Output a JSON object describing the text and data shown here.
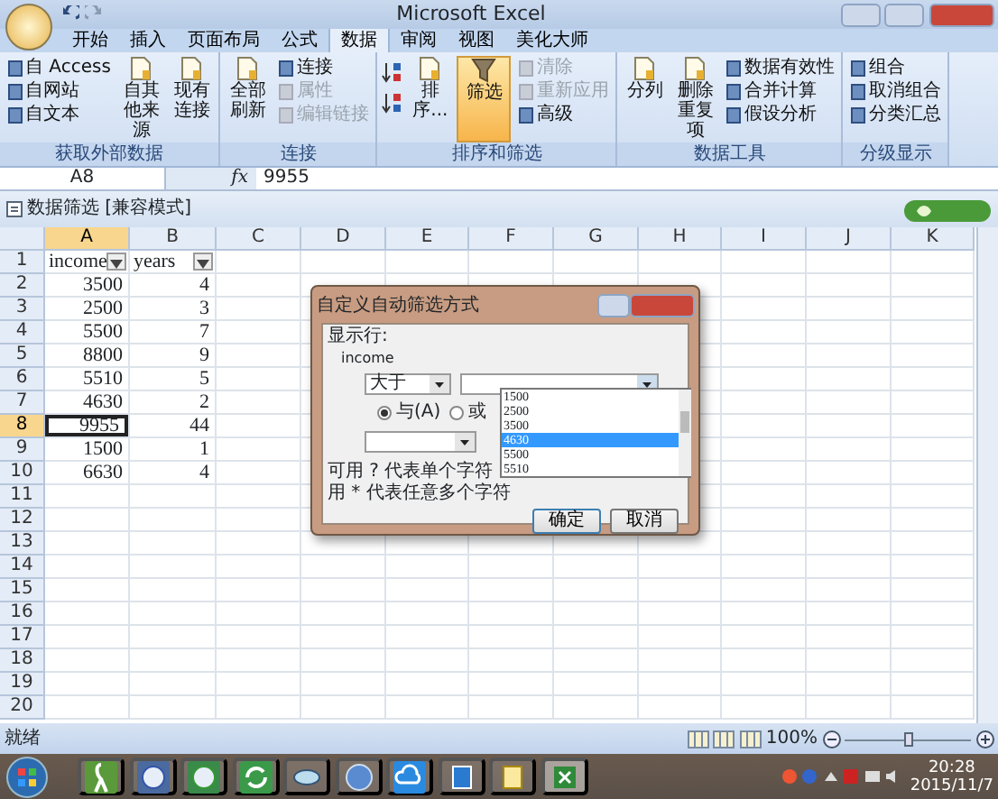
{
  "window": {
    "title": "Microsoft Excel"
  },
  "menu_tabs": [
    {
      "label": "开始",
      "selected": false
    },
    {
      "label": "插入",
      "selected": false
    },
    {
      "label": "页面布局",
      "selected": false
    },
    {
      "label": "公式",
      "selected": false
    },
    {
      "label": "数据",
      "selected": true
    },
    {
      "label": "审阅",
      "selected": false
    },
    {
      "label": "视图",
      "selected": false
    },
    {
      "label": "美化大师",
      "selected": false
    }
  ],
  "ribbon": {
    "groups": [
      {
        "label": "获取外部数据",
        "items": [
          {
            "kind": "small",
            "label": "自 Access",
            "disabled": false,
            "selected": false
          },
          {
            "kind": "small",
            "label": "自网站",
            "disabled": false,
            "selected": false
          },
          {
            "kind": "small",
            "label": "自文本",
            "disabled": false,
            "selected": false
          },
          {
            "kind": "large",
            "label": "自其他来源",
            "disabled": false,
            "selected": false
          },
          {
            "kind": "large",
            "label": "现有连接",
            "disabled": false,
            "selected": false
          }
        ]
      },
      {
        "label": "连接",
        "items": [
          {
            "kind": "large",
            "label": "全部刷新",
            "disabled": false,
            "selected": false
          },
          {
            "kind": "small",
            "label": "连接",
            "disabled": false,
            "selected": false
          },
          {
            "kind": "small",
            "label": "属性",
            "disabled": true,
            "selected": false
          },
          {
            "kind": "small",
            "label": "编辑链接",
            "disabled": true,
            "selected": false
          }
        ]
      },
      {
        "label": "排序和筛选",
        "items": [
          {
            "kind": "sort"
          },
          {
            "kind": "large",
            "label": "排序...",
            "disabled": false,
            "selected": false
          },
          {
            "kind": "large",
            "label": "筛选",
            "disabled": false,
            "selected": true
          },
          {
            "kind": "small",
            "label": "清除",
            "disabled": true,
            "selected": false
          },
          {
            "kind": "small",
            "label": "重新应用",
            "disabled": true,
            "selected": false
          },
          {
            "kind": "small",
            "label": "高级",
            "disabled": false,
            "selected": false
          }
        ]
      },
      {
        "label": "数据工具",
        "items": [
          {
            "kind": "large",
            "label": "分列",
            "disabled": false,
            "selected": false
          },
          {
            "kind": "large",
            "label": "删除重复项",
            "disabled": false,
            "selected": false
          },
          {
            "kind": "small",
            "label": "数据有效性",
            "disabled": false,
            "selected": false
          },
          {
            "kind": "small",
            "label": "合并计算",
            "disabled": false,
            "selected": false
          },
          {
            "kind": "small",
            "label": "假设分析",
            "disabled": false,
            "selected": false
          }
        ]
      },
      {
        "label": "分级显示",
        "items": [
          {
            "kind": "small",
            "label": "组合",
            "disabled": false,
            "selected": false
          },
          {
            "kind": "small",
            "label": "取消组合",
            "disabled": false,
            "selected": false
          },
          {
            "kind": "small",
            "label": "分类汇总",
            "disabled": false,
            "selected": false
          }
        ]
      }
    ]
  },
  "formula_bar": {
    "name_box": "A8",
    "function_label": "fx",
    "value": "9955"
  },
  "workbook": {
    "title": "数据筛选 [兼容模式]"
  },
  "sheet": {
    "columns": [
      {
        "label": "A",
        "selected": true
      },
      {
        "label": "B",
        "selected": false
      },
      {
        "label": "C",
        "selected": false
      },
      {
        "label": "D",
        "selected": false
      },
      {
        "label": "E",
        "selected": false
      },
      {
        "label": "F",
        "selected": false
      },
      {
        "label": "G",
        "selected": false
      },
      {
        "label": "H",
        "selected": false
      },
      {
        "label": "I",
        "selected": false
      },
      {
        "label": "J",
        "selected": false
      },
      {
        "label": "K",
        "selected": false
      }
    ],
    "header_row": {
      "header": "1",
      "selected": false,
      "cells": [
        "income",
        "years"
      ]
    },
    "rows": [
      {
        "header": "2",
        "selected": false,
        "cells": [
          "3500",
          "4"
        ]
      },
      {
        "header": "3",
        "selected": false,
        "cells": [
          "2500",
          "3"
        ]
      },
      {
        "header": "4",
        "selected": false,
        "cells": [
          "5500",
          "7"
        ]
      },
      {
        "header": "5",
        "selected": false,
        "cells": [
          "8800",
          "9"
        ]
      },
      {
        "header": "6",
        "selected": false,
        "cells": [
          "5510",
          "5"
        ]
      },
      {
        "header": "7",
        "selected": false,
        "cells": [
          "4630",
          "2"
        ]
      },
      {
        "header": "8",
        "selected": true,
        "cells": [
          "9955",
          "44"
        ]
      },
      {
        "header": "9",
        "selected": false,
        "cells": [
          "1500",
          "1"
        ]
      },
      {
        "header": "10",
        "selected": false,
        "cells": [
          "6630",
          "4"
        ]
      },
      {
        "header": "11",
        "selected": false
      },
      {
        "header": "12",
        "selected": false
      },
      {
        "header": "13",
        "selected": false
      },
      {
        "header": "14",
        "selected": false
      },
      {
        "header": "15",
        "selected": false
      },
      {
        "header": "16",
        "selected": false
      },
      {
        "header": "17",
        "selected": false
      },
      {
        "header": "18",
        "selected": false
      },
      {
        "header": "19",
        "selected": false
      },
      {
        "header": "20",
        "selected": false
      }
    ]
  },
  "dialog": {
    "title": "自定义自动筛选方式",
    "group_label": "显示行:",
    "field": "income",
    "operator_1": "大于",
    "value_options": [
      {
        "label": "1500",
        "selected": false
      },
      {
        "label": "2500",
        "selected": false
      },
      {
        "label": "3500",
        "selected": false
      },
      {
        "label": "4630",
        "selected": true
      },
      {
        "label": "5500",
        "selected": false
      },
      {
        "label": "5510",
        "selected": false
      }
    ],
    "logic": [
      {
        "label": "与(A)",
        "selected": true
      },
      {
        "label": "或",
        "selected": false
      }
    ],
    "hints": [
      "可用 ? 代表单个字符",
      "用 * 代表任意多个字符"
    ],
    "buttons": [
      "确定",
      "取消"
    ]
  },
  "status_bar": {
    "text": "就绪",
    "zoom": "100%",
    "zoom_slider": {
      "level": 0.5
    }
  },
  "taskbar": {
    "time": "20:28",
    "date": "2015/11/7"
  }
}
